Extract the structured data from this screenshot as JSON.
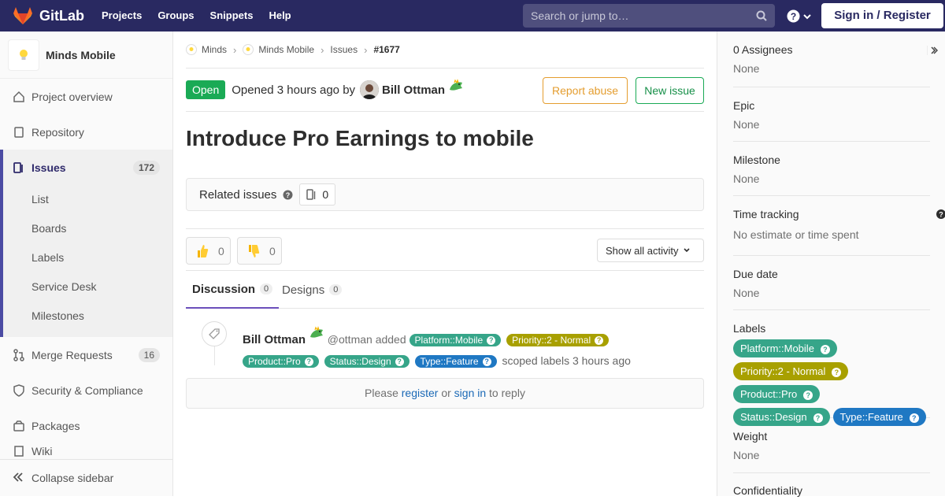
{
  "navbar": {
    "brand": "GitLab",
    "links": [
      "Projects",
      "Groups",
      "Snippets",
      "Help"
    ],
    "search_placeholder": "Search or jump to…",
    "signin": "Sign in / Register"
  },
  "sidebar": {
    "project_name": "Minds Mobile",
    "items": [
      {
        "label": "Project overview"
      },
      {
        "label": "Repository"
      },
      {
        "label": "Issues",
        "count": "172"
      },
      {
        "label": "Merge Requests",
        "count": "16"
      },
      {
        "label": "Security & Compliance"
      },
      {
        "label": "Packages"
      },
      {
        "label": "Wiki"
      }
    ],
    "sub_items": [
      "List",
      "Boards",
      "Labels",
      "Service Desk",
      "Milestones"
    ],
    "collapse": "Collapse sidebar"
  },
  "breadcrumb": [
    "Minds",
    "Minds Mobile",
    "Issues",
    "#1677"
  ],
  "issue": {
    "status": "Open",
    "opened": "Opened 3 hours ago by",
    "author": "Bill Ottman",
    "report_abuse": "Report abuse",
    "new_issue": "New issue",
    "title": "Introduce Pro Earnings to mobile",
    "related_label": "Related issues",
    "related_count": "0",
    "thumbs_up": "0",
    "thumbs_down": "0",
    "activity_filter": "Show all activity",
    "tabs": [
      {
        "label": "Discussion",
        "count": "0"
      },
      {
        "label": "Designs",
        "count": "0"
      }
    ]
  },
  "note": {
    "author": "Bill Ottman",
    "handle": "@ottman added",
    "suffix": "scoped labels 3 hours ago"
  },
  "labels": [
    {
      "text": "Platform::Mobile",
      "color": "#36a589"
    },
    {
      "text": "Priority::2 - Normal",
      "color": "#a8a000"
    },
    {
      "text": "Product::Pro",
      "color": "#36a589"
    },
    {
      "text": "Status::Design",
      "color": "#36a589"
    },
    {
      "text": "Type::Feature",
      "color": "#1f78c3"
    }
  ],
  "reply": {
    "please": "Please",
    "register": "register",
    "or": "or",
    "signin": "sign in",
    "tail": "to reply"
  },
  "right_sidebar": {
    "assignees_title": "0 Assignees",
    "assignees_value": "None",
    "epic_title": "Epic",
    "epic_value": "None",
    "milestone_title": "Milestone",
    "milestone_value": "None",
    "time_title": "Time tracking",
    "time_value": "No estimate or time spent",
    "due_title": "Due date",
    "due_value": "None",
    "labels_title": "Labels",
    "weight_title": "Weight",
    "weight_value": "None",
    "confidentiality_title": "Confidentiality"
  },
  "colors": {
    "navbar": "#292961",
    "open": "#1aaa55",
    "abuse": "#e49d2f",
    "link": "#1b69b6"
  }
}
